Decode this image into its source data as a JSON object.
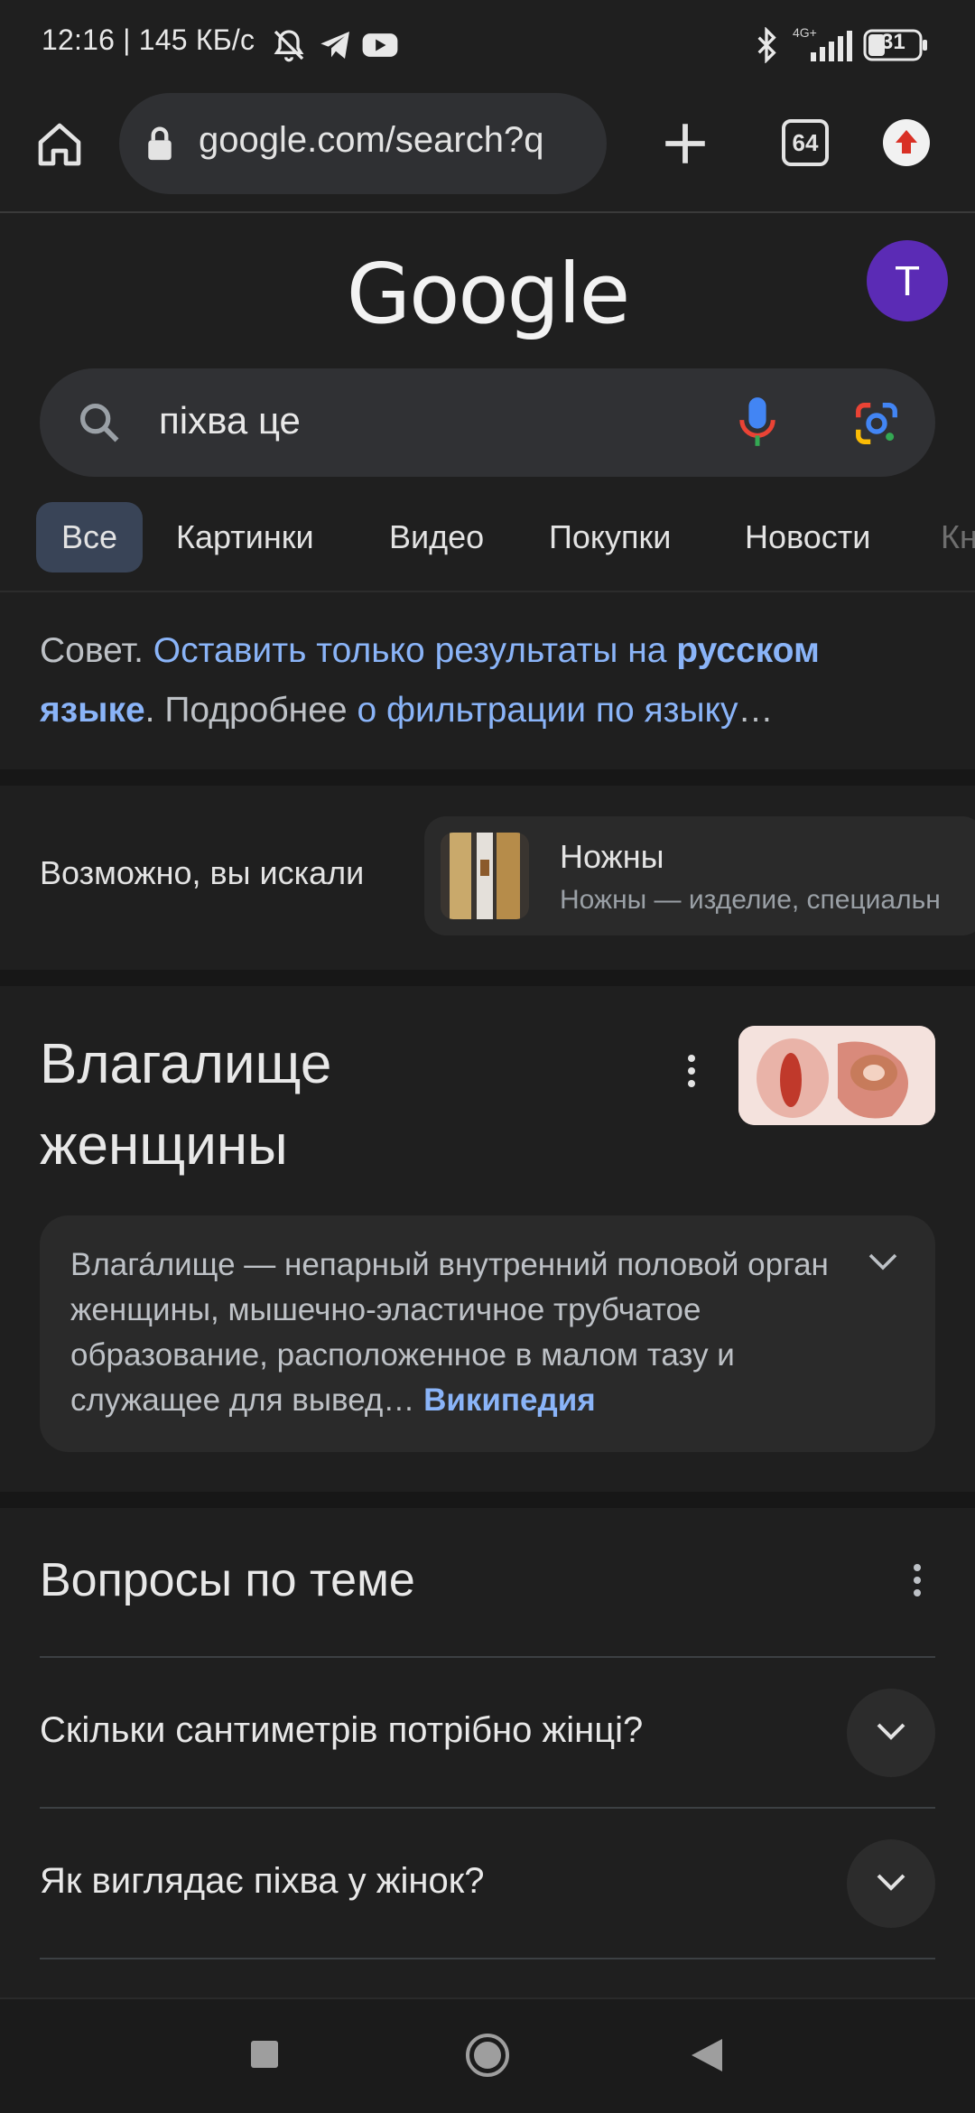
{
  "status_bar": {
    "left_text": "12:16 | 145 КБ/с",
    "network": "4G+",
    "battery": "31"
  },
  "browser": {
    "url": "google.com/search?q",
    "tab_count": "64"
  },
  "google": {
    "logo": "Google",
    "avatar_letter": "T",
    "search_query": "піхва це",
    "tabs": [
      "Все",
      "Картинки",
      "Видео",
      "Покупки",
      "Новости",
      "Кн"
    ]
  },
  "tip": {
    "prefix": "Совет. ",
    "link1": "Оставить только результаты на ",
    "link1_bold": "русском языке",
    "middle": ". Подробнее ",
    "link2": "о фильтрации по языку",
    "suffix": "…"
  },
  "did_you_mean": {
    "label": "Возможно, вы искали",
    "title": "Ножны",
    "subtitle": "Ножны — изделие, специальн"
  },
  "knowledge_panel": {
    "title": "Влагалище женщины",
    "description": "Влага́лище — непарный внутренний половой орган женщины, мышечно-эластичное трубчатое образование, расположенное в малом тазу и служащее для вывед",
    "ellipsis": "… ",
    "source": "Википедия"
  },
  "questions": {
    "heading": "Вопросы по теме",
    "items": [
      "Скільки сантиметрів потрібно жінці?",
      "Як виглядає піхва у жінок?"
    ]
  },
  "colors": {
    "background": "#1f1f1f",
    "link": "#8ab4f8",
    "avatar": "#5b2bb5",
    "active_tab": "#394457"
  }
}
